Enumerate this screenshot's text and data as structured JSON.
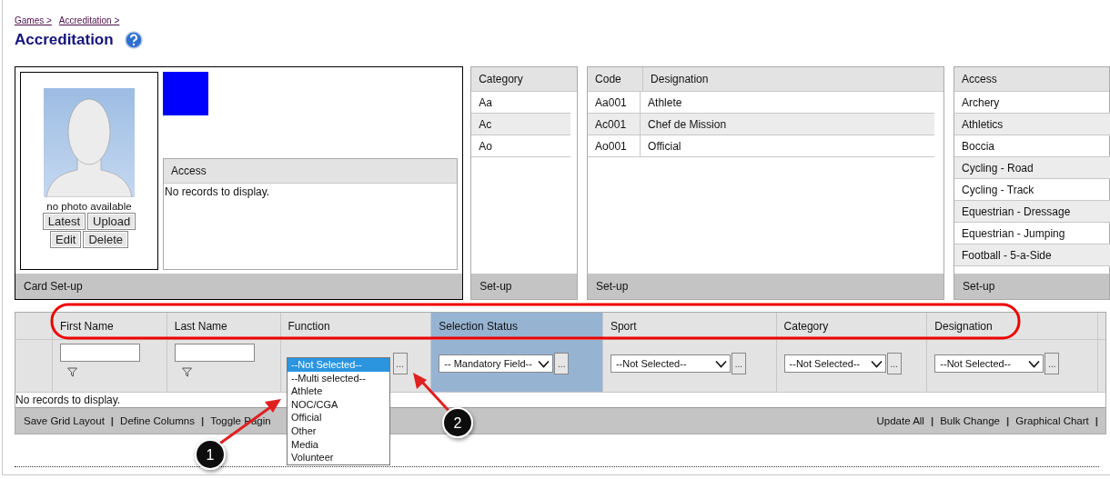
{
  "breadcrumb": [
    {
      "label": "Games >"
    },
    {
      "label": "Accreditation >"
    }
  ],
  "title": "Accreditation",
  "card_panel": {
    "photo_caption": "no photo available",
    "photo_buttons": [
      {
        "label": "Latest"
      },
      {
        "label": "Upload"
      },
      {
        "label": "Edit"
      },
      {
        "label": "Delete"
      }
    ],
    "access": {
      "header": "Access",
      "empty_text": "No records to display."
    },
    "footer": "Card Set-up"
  },
  "category_panel": {
    "header": "Category",
    "rows": [
      "Aa",
      "Ac",
      "Ao"
    ],
    "footer": "Set-up"
  },
  "designation_panel": {
    "headers": [
      "Code",
      "Designation"
    ],
    "rows": [
      {
        "code": "Aa001",
        "designation": "Athlete"
      },
      {
        "code": "Ac001",
        "designation": "Chef de Mission"
      },
      {
        "code": "Ao001",
        "designation": "Official"
      }
    ],
    "footer": "Set-up"
  },
  "access_panel": {
    "header": "Access",
    "rows": [
      "Archery",
      "Athletics",
      "Boccia",
      "Cycling - Road",
      "Cycling - Track",
      "Equestrian - Dressage",
      "Equestrian - Jumping",
      "Football - 5-a-Side"
    ],
    "footer": "Set-up"
  },
  "grid": {
    "columns": [
      {
        "label": "First Name",
        "highlighted": false,
        "filter": {
          "kind": "text"
        }
      },
      {
        "label": "Last Name",
        "highlighted": false,
        "filter": {
          "kind": "text"
        }
      },
      {
        "label": "Function",
        "highlighted": false,
        "filter": {
          "kind": "listbox",
          "button": "...",
          "options": [
            {
              "label": "--Not Selected--",
              "selected": true
            },
            {
              "label": "--Multi selected--",
              "selected": false
            },
            {
              "label": "Athlete",
              "selected": false
            },
            {
              "label": "NOC/CGA",
              "selected": false
            },
            {
              "label": "Official",
              "selected": false
            },
            {
              "label": "Other",
              "selected": false
            },
            {
              "label": "Media",
              "selected": false
            },
            {
              "label": "Volunteer",
              "selected": false
            }
          ]
        }
      },
      {
        "label": "Selection Status",
        "highlighted": true,
        "filter": {
          "kind": "select",
          "value": "-- Mandatory Field--",
          "button": "..."
        }
      },
      {
        "label": "Sport",
        "highlighted": false,
        "filter": {
          "kind": "select",
          "value": "--Not Selected--",
          "button": "..."
        }
      },
      {
        "label": "Category",
        "highlighted": false,
        "filter": {
          "kind": "select",
          "value": "--Not Selected--",
          "button": "..."
        }
      },
      {
        "label": "Designation",
        "highlighted": false,
        "filter": {
          "kind": "select",
          "value": "--Not Selected--",
          "button": "..."
        }
      }
    ],
    "empty_text": "No records to display.",
    "footer_left": [
      {
        "kind": "link",
        "label": "Save Grid Layout"
      },
      {
        "kind": "separator",
        "label": "|"
      },
      {
        "kind": "link",
        "label": "Define Columns"
      },
      {
        "kind": "separator",
        "label": "|"
      },
      {
        "kind": "link",
        "label": "Toggle Pagin"
      }
    ],
    "footer_right": [
      {
        "kind": "link",
        "label": "Update All"
      },
      {
        "kind": "separator",
        "label": "|"
      },
      {
        "kind": "link",
        "label": "Bulk Change"
      },
      {
        "kind": "separator",
        "label": "|"
      },
      {
        "kind": "link",
        "label": "Graphical Chart"
      },
      {
        "kind": "separator",
        "label": "|"
      }
    ]
  },
  "annotations": [
    {
      "number": "1"
    },
    {
      "number": "2"
    }
  ]
}
